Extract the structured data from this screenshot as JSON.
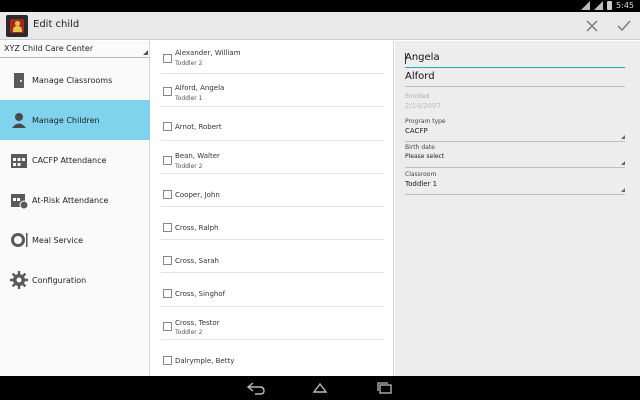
{
  "status_bar": {
    "time": "5:45"
  },
  "action_bar": {
    "title": "Edit child",
    "close_icon": "close-icon",
    "save_icon": "check-icon"
  },
  "sidebar": {
    "center_select": "XYZ Child Care Center",
    "items": [
      {
        "label": "Manage Classrooms",
        "icon": "door-icon",
        "active": false
      },
      {
        "label": "Manage Children",
        "icon": "child-icon",
        "active": true
      },
      {
        "label": "CACFP Attendance",
        "icon": "calendar-icon",
        "active": false
      },
      {
        "label": "At-Risk Attendance",
        "icon": "calendar-alert-icon",
        "active": false
      },
      {
        "label": "Meal Service",
        "icon": "plate-icon",
        "active": false
      },
      {
        "label": "Configuration",
        "icon": "gear-icon",
        "active": false
      }
    ]
  },
  "children": [
    {
      "name": "Alexander, William",
      "classroom": "Toddler 2"
    },
    {
      "name": "Alford, Angela",
      "classroom": "Toddler 1"
    },
    {
      "name": "Arnot, Robert",
      "classroom": ""
    },
    {
      "name": "Bean, Walter",
      "classroom": "Toddler 2"
    },
    {
      "name": "Cooper, John",
      "classroom": ""
    },
    {
      "name": "Cross, Ralph",
      "classroom": ""
    },
    {
      "name": "Cross, Sarah",
      "classroom": ""
    },
    {
      "name": "Cross, Singhof",
      "classroom": ""
    },
    {
      "name": "Cross, Testor",
      "classroom": "Toddler 2"
    },
    {
      "name": "Dalrymple, Betty",
      "classroom": ""
    }
  ],
  "detail": {
    "first_name": "Angela",
    "last_name": "Alford",
    "enrolled_label": "Enrolled",
    "enrolled_value": "2/14/2007",
    "program_type_label": "Program type",
    "program_type_value": "CACFP",
    "birth_date_label": "Birth date",
    "birth_date_value": "Please select",
    "classroom_label": "Classroom",
    "classroom_value": "Toddler 1"
  },
  "colors": {
    "active_nav": "#7fd3ec",
    "focus_underline": "#2aa6c4"
  }
}
